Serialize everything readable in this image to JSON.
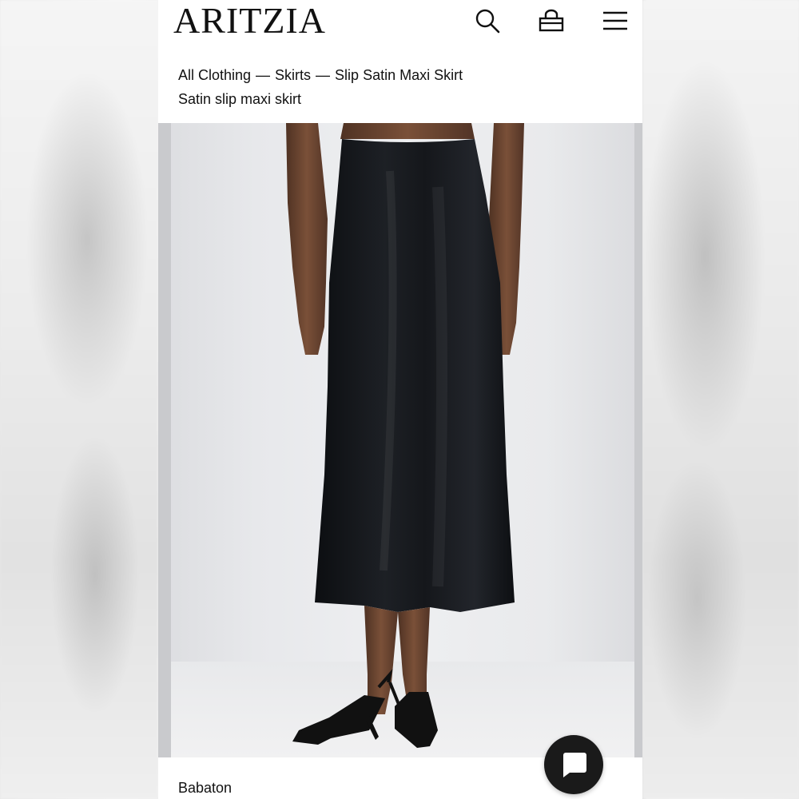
{
  "header": {
    "logo": "ARITZIA",
    "icons": [
      "search-icon",
      "bag-icon",
      "menu-icon"
    ]
  },
  "breadcrumb": {
    "items": [
      "All Clothing",
      "Skirts",
      "Slip Satin Maxi Skirt"
    ],
    "separator": "—"
  },
  "product": {
    "subtitle": "Satin slip maxi skirt",
    "brand": "Babaton",
    "image_description_colors": {
      "skirt": "#15171b",
      "background": "#eceded",
      "skin": "#6b4631",
      "shoe": "#111111"
    }
  },
  "chat": {
    "icon": "chat-bubble-icon",
    "color": "#1a1a1a"
  }
}
